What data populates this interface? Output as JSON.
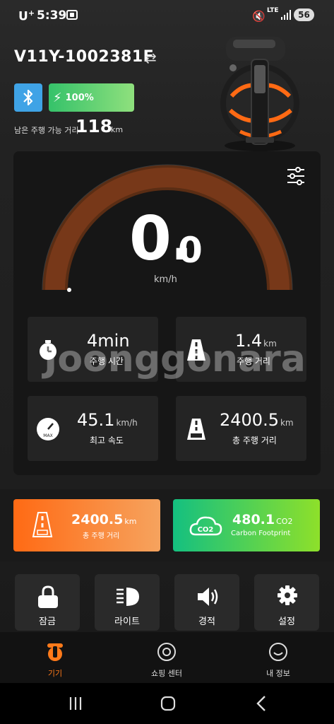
{
  "status_bar": {
    "carrier": "U",
    "carrier_sup": "+",
    "time": "5:39",
    "network": "LTE",
    "battery": "56"
  },
  "device": {
    "name": "V11Y-1002381F"
  },
  "battery": {
    "percent": "100%"
  },
  "range": {
    "label": "남은 주행 가능 거리",
    "value": "118",
    "unit": "km"
  },
  "speed": {
    "integer": "0.",
    "decimal": "0",
    "unit": "km/h",
    "gauge_fraction": 0
  },
  "stats": [
    {
      "value": "4min",
      "unit": "",
      "label": "주행 시간",
      "icon": "stopwatch-icon"
    },
    {
      "value": "1.4",
      "unit": "km",
      "label": "주행 거리",
      "icon": "road-icon"
    },
    {
      "value": "45.1",
      "unit": "km/h",
      "label": "최고 속도",
      "icon": "max-gauge-icon"
    },
    {
      "value": "2400.5",
      "unit": "km",
      "label": "총 주행 거리",
      "icon": "odometer-road-icon"
    }
  ],
  "watermark": "Joonggonara",
  "cards": {
    "total": {
      "value": "2400.5",
      "unit": "km",
      "label": "총 주행 거리"
    },
    "carbon": {
      "value": "480.1",
      "unit": "CO2",
      "label": "Carbon Footprint"
    }
  },
  "quick_actions": [
    {
      "label": "잠금",
      "icon": "lock-icon"
    },
    {
      "label": "라이트",
      "icon": "headlight-icon"
    },
    {
      "label": "경적",
      "icon": "horn-icon"
    },
    {
      "label": "설정",
      "icon": "gear-icon"
    }
  ],
  "tabs": [
    {
      "label": "기기",
      "active": true
    },
    {
      "label": "쇼핑 센터",
      "active": false
    },
    {
      "label": "내 정보",
      "active": false
    }
  ],
  "colors": {
    "accent": "#ff7a1a",
    "gauge": "#7a3a1a",
    "bluetooth": "#3fa3e6",
    "battery": "#35c26a"
  }
}
